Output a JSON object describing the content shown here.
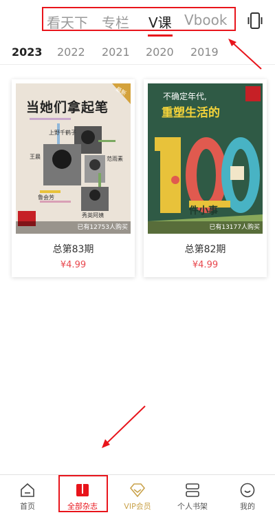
{
  "top_tabs": [
    {
      "label": "看天下"
    },
    {
      "label": "专栏"
    },
    {
      "label": "V课"
    },
    {
      "label": "Vbook"
    }
  ],
  "years": [
    "2023",
    "2022",
    "2021",
    "2020",
    "2019"
  ],
  "magazines": [
    {
      "title": "总第83期",
      "price": "¥4.99",
      "buyers": "已有12753人购买",
      "cover_headline": "当她们拿起笔",
      "cover_badge": "最新",
      "cover_names": [
        "上野千鹤子",
        "王晨",
        "范雨素",
        "鲁会芳",
        "秀英阿姨"
      ]
    },
    {
      "title": "总第82期",
      "price": "¥4.99",
      "buyers": "已有13177人购买",
      "cover_line1": "不确定年代,",
      "cover_line2": "重塑生活的",
      "cover_number": "100",
      "cover_line3": "件小事"
    }
  ],
  "bottom_nav": [
    {
      "label": "首页",
      "icon": "home-icon"
    },
    {
      "label": "全部杂志",
      "icon": "book-icon"
    },
    {
      "label": "VIP会员",
      "icon": "vip-diamond-icon"
    },
    {
      "label": "个人书架",
      "icon": "bookshelf-icon"
    },
    {
      "label": "我的",
      "icon": "profile-icon"
    }
  ],
  "colors": {
    "accent": "#e8141b",
    "price": "#e8474d",
    "vip": "#c9a24a",
    "cover2_bg": "#2f5a45"
  }
}
